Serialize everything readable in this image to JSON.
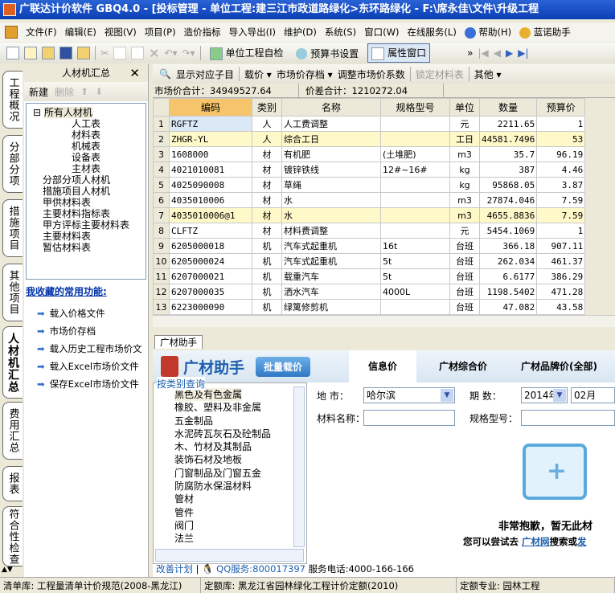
{
  "title": "广联达计价软件 GBQ4.0 - [投标管理 - 单位工程:建三江市政道路绿化>东环路绿化 - F:\\席永佳\\文件\\升级工程",
  "menu": [
    "文件(F)",
    "编辑(E)",
    "视图(V)",
    "项目(P)",
    "造价指标",
    "导入导出(I)",
    "维护(D)",
    "系统(S)",
    "窗口(W)",
    "在线服务(L)",
    "帮助(H)",
    "蓝诺助手"
  ],
  "toolbar": {
    "self_check": "单位工程自检",
    "budget_settings": "预算书设置",
    "property_window": "属性窗口"
  },
  "vtabs": [
    "工程概况",
    "分部分项",
    "措施项目",
    "其他项目",
    "人材机汇总",
    "费用汇总",
    "报表",
    "符合性检查"
  ],
  "left_panel": {
    "title": "人材机汇总",
    "new": "新建",
    "delete": "删除",
    "tree_root": "所有人材机",
    "tree_children": [
      "人工表",
      "材料表",
      "机械表",
      "设备表",
      "主材表"
    ],
    "tree_items": [
      "分部分项人材机",
      "措施项目人材机",
      "甲供材料表",
      "主要材料指标表",
      "甲方评标主要材料表",
      "主要材料表",
      "暂估材料表"
    ],
    "fav_title": "我收藏的常用功能:",
    "fav_items": [
      "载入价格文件",
      "市场价存档",
      "载入历史工程市场价文",
      "载入Excel市场价文件",
      "保存Excel市场价文件"
    ]
  },
  "main_toolbar": {
    "show_sub": "显示对应子目",
    "load_price": "载价",
    "archive": "市场价存档",
    "adjust": "调整市场价系数",
    "lock": "锁定材料表",
    "other": "其他"
  },
  "sums": {
    "market": "市场价合计：34949527.64",
    "diff": "价差合计：1210272.04"
  },
  "table": {
    "headers": [
      "",
      "编码",
      "类别",
      "名称",
      "规格型号",
      "单位",
      "数量",
      "预算价"
    ],
    "rows": [
      [
        "1",
        "RGFTZ",
        "人",
        "人工费调整",
        "",
        "元",
        "2211.65",
        "1"
      ],
      [
        "2",
        "ZHGR-YL",
        "人",
        "综合工日",
        "",
        "工日",
        "44581.7496",
        "53"
      ],
      [
        "3",
        "1608000",
        "材",
        "有机肥",
        "(土堆肥)",
        "m3",
        "35.7",
        "96.19"
      ],
      [
        "4",
        "4021010081",
        "材",
        "镀锌铁线",
        "12#~16#",
        "kg",
        "387",
        "4.46"
      ],
      [
        "5",
        "4025090008",
        "材",
        "草绳",
        "",
        "kg",
        "95868.05",
        "3.87"
      ],
      [
        "6",
        "4035010006",
        "材",
        "水",
        "",
        "m3",
        "27874.046",
        "7.59"
      ],
      [
        "7",
        "4035010006@1",
        "材",
        "水",
        "",
        "m3",
        "4655.8836",
        "7.59"
      ],
      [
        "8",
        "CLFTZ",
        "材",
        "材料费调整",
        "",
        "元",
        "5454.1069",
        "1"
      ],
      [
        "9",
        "6205000018",
        "机",
        "汽车式起重机",
        "16t",
        "台班",
        "366.18",
        "907.11"
      ],
      [
        "10",
        "6205000024",
        "机",
        "汽车式起重机",
        "5t",
        "台班",
        "262.034",
        "461.37"
      ],
      [
        "11",
        "6207000021",
        "机",
        "载重汽车",
        "5t",
        "台班",
        "6.6177",
        "386.29"
      ],
      [
        "12",
        "6207000035",
        "机",
        "洒水汽车",
        "4000L",
        "台班",
        "1198.5402",
        "471.28"
      ],
      [
        "13",
        "6223000090",
        "机",
        "绿篱修剪机",
        "",
        "台班",
        "47.082",
        "43.58"
      ]
    ]
  },
  "bottom": {
    "tab": "广材助手",
    "logo": "广材助手",
    "batch": "批量载价",
    "tabs": [
      "信息价",
      "广材综合价",
      "广材品牌价(全部)"
    ],
    "cat_title": "按类别查询",
    "categories": [
      "黑色及有色金属",
      "橡胶、塑料及非金属",
      "五金制品",
      "水泥砖瓦灰石及砼制品",
      "木、竹材及其制品",
      "装饰石材及地板",
      "门窗制品及门窗五金",
      "防腐防水保温材料",
      "管材",
      "管件",
      "阀门",
      "法兰"
    ],
    "city_label": "地    市：",
    "city": "哈尔滨",
    "period_label": "期    数：",
    "year": "2014年",
    "month": "02月",
    "name_label": "材料名称：",
    "spec_label": "规格型号：",
    "sorry": "非常抱歉，暂无此材",
    "try_prefix": "您可以尝试去",
    "try_link": "广材网",
    "try_suffix": "搜索或",
    "try_tail": "发",
    "improve": "改善计划",
    "qq": "QQ服务:800017397",
    "phone": "服务电话:4000-166-166"
  },
  "status": {
    "list": "清单库: 工程量清单计价规范(2008-黑龙江)",
    "quota": "定额库: 黑龙江省园林绿化工程计价定额(2010)",
    "major": "定额专业: 园林工程"
  }
}
